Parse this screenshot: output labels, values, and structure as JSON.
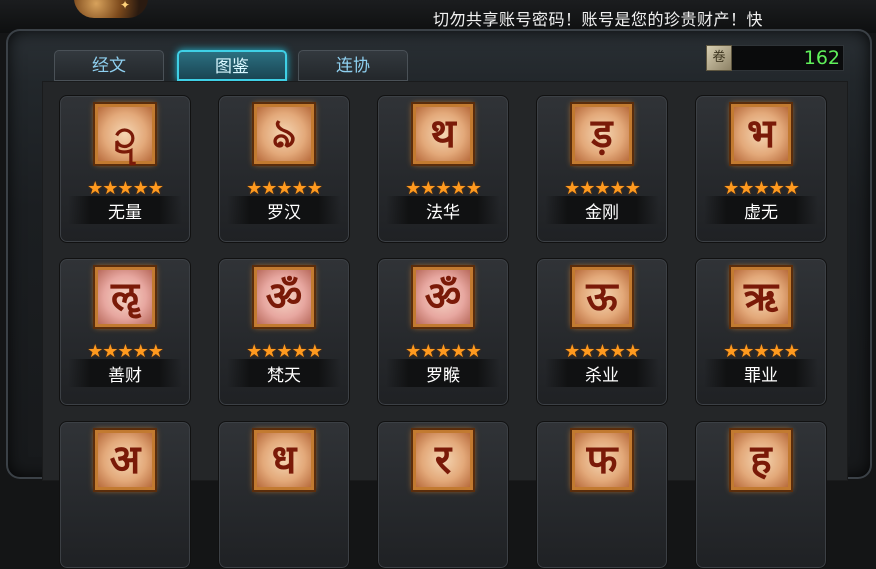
{
  "announcement": "切勿共享账号密码！账号是您的珍贵财产！快",
  "tabs": [
    {
      "label": "经文",
      "active": false
    },
    {
      "label": "图鉴",
      "active": true
    },
    {
      "label": "连协",
      "active": false
    }
  ],
  "currency": {
    "icon": "scroll-icon",
    "value": "162"
  },
  "cards": [
    {
      "name": "无量",
      "glyph": "ဍ",
      "stars": "★★★★★"
    },
    {
      "name": "罗汉",
      "glyph": "ঌ",
      "stars": "★★★★★"
    },
    {
      "name": "法华",
      "glyph": "थ",
      "stars": "★★★★★"
    },
    {
      "name": "金刚",
      "glyph": "ड़",
      "stars": "★★★★★"
    },
    {
      "name": "虚无",
      "glyph": "भ",
      "stars": "★★★★★"
    },
    {
      "name": "善财",
      "glyph": "ॡ",
      "stars": "★★★★★"
    },
    {
      "name": "梵天",
      "glyph": "ॐ",
      "stars": "★★★★★"
    },
    {
      "name": "罗睺",
      "glyph": "ॐ",
      "stars": "★★★★★"
    },
    {
      "name": "杀业",
      "glyph": "ऊ",
      "stars": "★★★★★"
    },
    {
      "name": "罪业",
      "glyph": "ऋ",
      "stars": "★★★★★"
    },
    {
      "name": "",
      "glyph": "अ",
      "stars": ""
    },
    {
      "name": "",
      "glyph": "ध",
      "stars": ""
    },
    {
      "name": "",
      "glyph": "र",
      "stars": ""
    },
    {
      "name": "",
      "glyph": "फ",
      "stars": ""
    },
    {
      "name": "",
      "glyph": "ह",
      "stars": ""
    }
  ],
  "colors": {
    "accent": "#3fd0e6",
    "star": "#ff9a1f",
    "counter": "#5ff05a"
  }
}
